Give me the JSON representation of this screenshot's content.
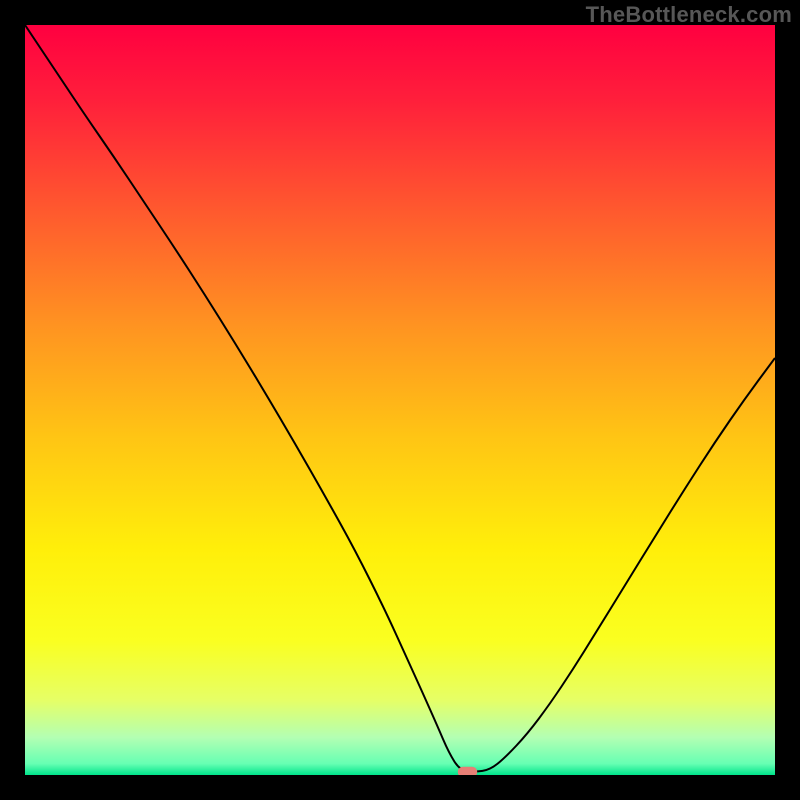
{
  "watermark": "TheBottleneck.com",
  "chart_data": {
    "type": "line",
    "title": "",
    "xlabel": "",
    "ylabel": "",
    "xlim": [
      0,
      100
    ],
    "ylim": [
      0,
      100
    ],
    "grid": false,
    "legend": false,
    "background": {
      "style": "vertical-gradient",
      "stops": [
        {
          "pos": 0.0,
          "color": "#ff0040"
        },
        {
          "pos": 0.1,
          "color": "#ff1f3b"
        },
        {
          "pos": 0.25,
          "color": "#ff5a2e"
        },
        {
          "pos": 0.4,
          "color": "#ff9321"
        },
        {
          "pos": 0.55,
          "color": "#ffc514"
        },
        {
          "pos": 0.7,
          "color": "#ffef0a"
        },
        {
          "pos": 0.82,
          "color": "#faff20"
        },
        {
          "pos": 0.9,
          "color": "#e6ff66"
        },
        {
          "pos": 0.95,
          "color": "#b3ffb3"
        },
        {
          "pos": 0.985,
          "color": "#66ffb3"
        },
        {
          "pos": 1.0,
          "color": "#00e48b"
        }
      ]
    },
    "series": [
      {
        "name": "bottleneck-curve",
        "color": "#000000",
        "x": [
          0,
          2,
          5,
          8,
          12,
          16,
          20,
          24,
          28,
          32,
          36,
          40,
          44,
          48,
          51,
          53,
          55,
          56.5,
          58,
          60,
          62,
          64,
          67,
          70,
          73,
          76,
          80,
          84,
          88,
          92,
          96,
          100
        ],
        "y": [
          100,
          97,
          92.5,
          88,
          82.2,
          76.2,
          70.2,
          64,
          57.6,
          51,
          44.2,
          37.2,
          30,
          22,
          15.4,
          11,
          6.5,
          3,
          0.6,
          0.4,
          0.7,
          2.3,
          5.5,
          9.5,
          14,
          18.8,
          25.3,
          31.8,
          38.2,
          44.4,
          50.2,
          55.6
        ]
      }
    ],
    "marker": {
      "name": "optimal-point",
      "x": 59,
      "y": 0.4,
      "color": "#e77f76",
      "shape": "capsule"
    }
  }
}
